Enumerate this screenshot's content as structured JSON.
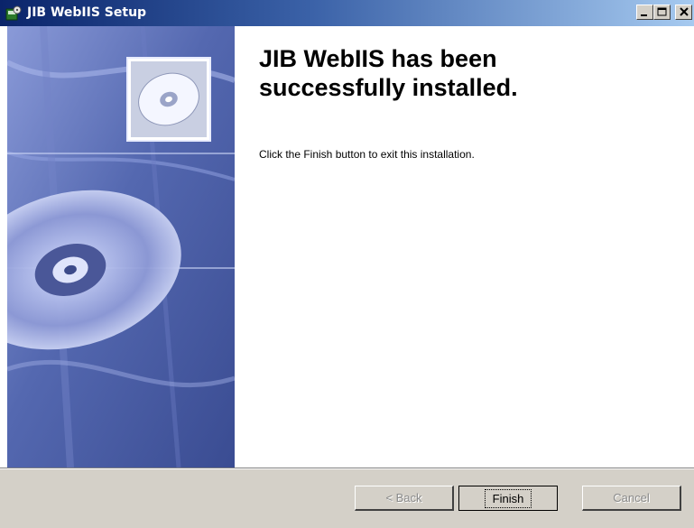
{
  "window": {
    "title": "JIB WebIIS Setup",
    "icon": "setup-app-icon",
    "controls": [
      "minimize-icon",
      "maximize-icon",
      "close-icon"
    ]
  },
  "main": {
    "heading": "JIB WebIIS has been\nsuccessfully installed.",
    "body": "Click the Finish button to exit this installation.",
    "banner_image": "cd-disc-banner"
  },
  "buttons": {
    "back": "< Back",
    "finish": "Finish",
    "cancel": "Cancel"
  },
  "colors": {
    "titlebar_start": "#0a246a",
    "titlebar_end": "#a6caf0",
    "dialog_bg": "#d4d0c8",
    "banner_base": "#5a6fb0"
  }
}
